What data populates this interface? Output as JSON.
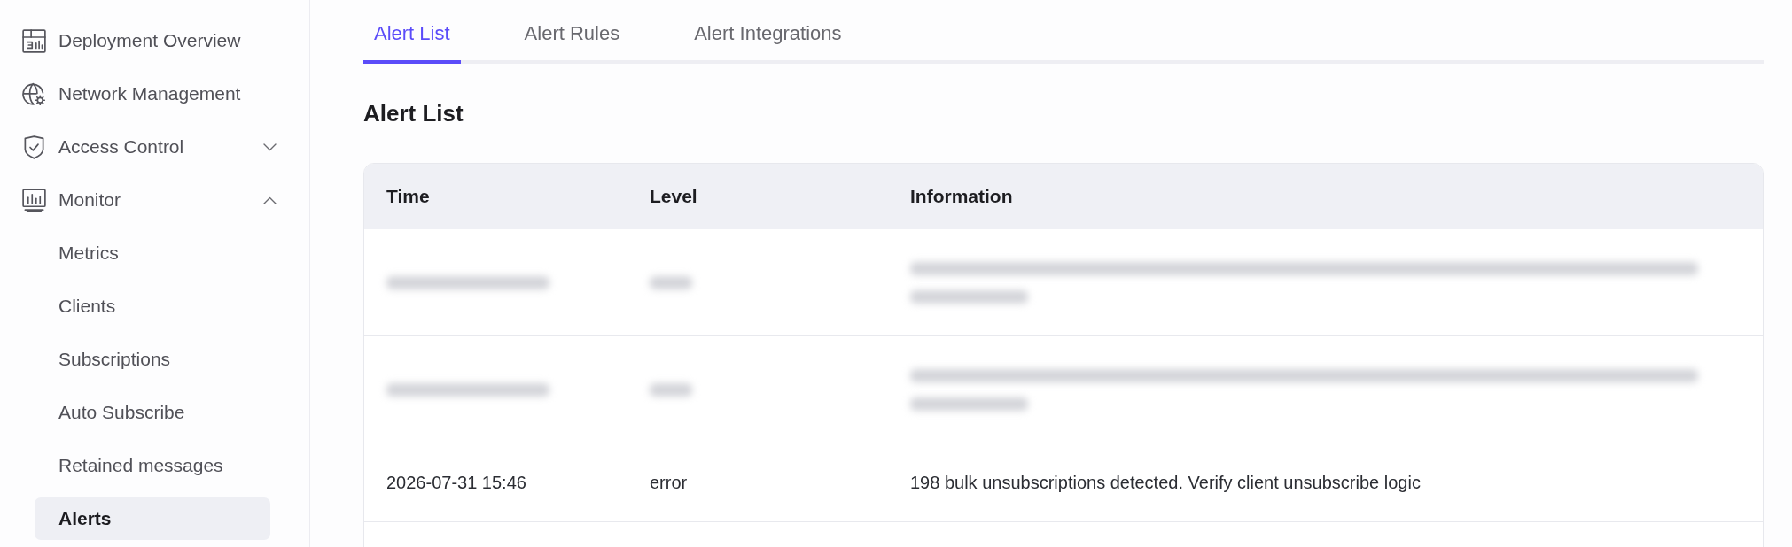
{
  "sidebar": {
    "items": [
      {
        "kind": "link",
        "label": "Deployment Overview",
        "selected": false
      },
      {
        "kind": "link",
        "label": "Network Management",
        "selected": false
      },
      {
        "kind": "group",
        "label": "Access Control",
        "selected": false,
        "expanded": false
      },
      {
        "kind": "group",
        "label": "Monitor",
        "selected": false,
        "expanded": true,
        "children": [
          {
            "label": "Metrics",
            "selected": false
          },
          {
            "label": "Clients",
            "selected": false
          },
          {
            "label": "Subscriptions",
            "selected": false
          },
          {
            "label": "Auto Subscribe",
            "selected": false
          },
          {
            "label": "Retained messages",
            "selected": false
          },
          {
            "label": "Alerts",
            "selected": true
          }
        ]
      }
    ]
  },
  "tabs": [
    {
      "label": "Alert List",
      "selected": true
    },
    {
      "label": "Alert Rules",
      "selected": false
    },
    {
      "label": "Alert Integrations",
      "selected": false
    }
  ],
  "heading": "Alert List",
  "table": {
    "columns": [
      "Time",
      "Level",
      "Information"
    ],
    "rows": [
      {
        "blurred": true
      },
      {
        "blurred": true
      },
      {
        "blurred": false,
        "time": "2026-07-31 15:46",
        "level": "error",
        "information": "198 bulk unsubscriptions detected. Verify client unsubscribe logic"
      }
    ]
  }
}
